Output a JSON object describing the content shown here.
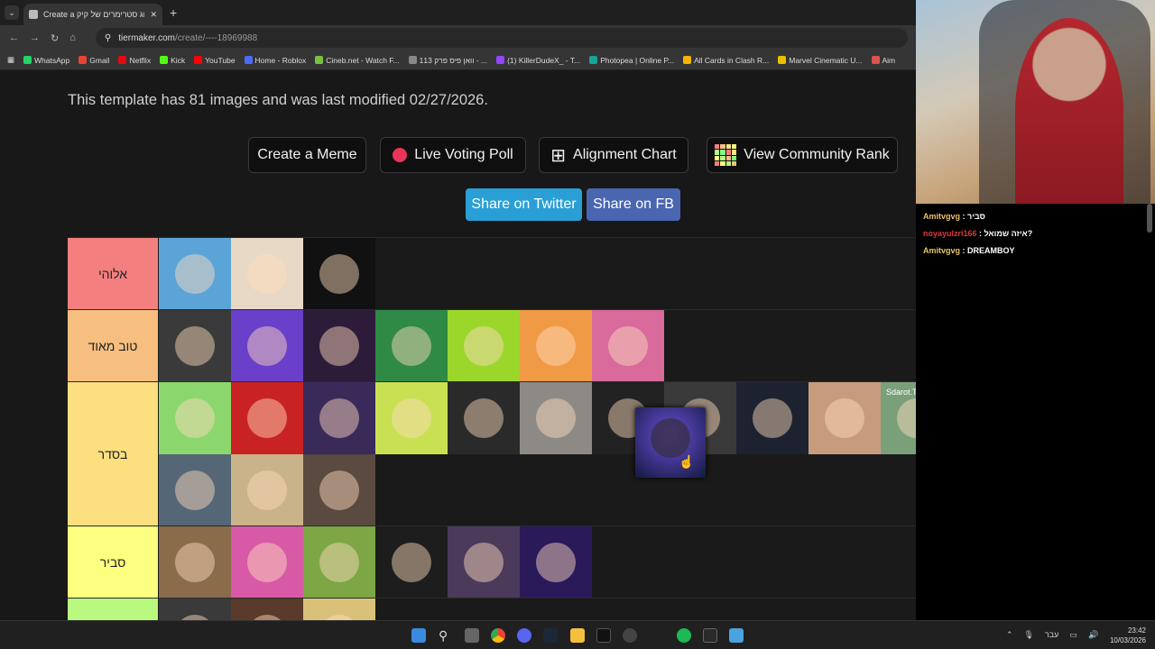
{
  "browser": {
    "tab_title": "Create a בירוג סטרימרים של קיק",
    "url_host": "tiermaker.com",
    "url_path": "/create/----18969988",
    "bookmarks": [
      {
        "label": "WhatsApp",
        "color": "#25d366"
      },
      {
        "label": "Gmail",
        "color": "#ea4335"
      },
      {
        "label": "Netflix",
        "color": "#e50914"
      },
      {
        "label": "Kick",
        "color": "#53fc18"
      },
      {
        "label": "YouTube",
        "color": "#ff0000"
      },
      {
        "label": "Home - Roblox",
        "color": "#4a6cf7"
      },
      {
        "label": "Cineb.net - Watch F...",
        "color": "#7ac143"
      },
      {
        "label": "וואן פיס פרק 113 - ...",
        "color": "#888888"
      },
      {
        "label": "(1) KillerDudeX_ - T...",
        "color": "#9146ff"
      },
      {
        "label": "Photopea | Online P...",
        "color": "#18a497"
      },
      {
        "label": "All Cards in Clash R...",
        "color": "#f5b400"
      },
      {
        "label": "Marvel Cinematic U...",
        "color": "#e8c000"
      },
      {
        "label": "Aim",
        "color": "#d9534f"
      }
    ]
  },
  "page": {
    "info_text": "This template has 81 images and was last modified 02/27/2026.",
    "buttons": {
      "create_meme": "Create a Meme",
      "live_poll": "Live Voting Poll",
      "alignment": "Alignment Chart",
      "community_rank": "View Community Rank",
      "share_twitter": "Share on Twitter",
      "share_fb": "Share on FB"
    },
    "tiers": [
      {
        "label": "אלוהי",
        "color": "#f47f7f",
        "items": [
          "#5ba4d8",
          "#e8d9c6",
          "#111111"
        ]
      },
      {
        "label": "טוב מאוד",
        "color": "#f6bf7f",
        "items": [
          "#3a3a3a",
          "#6a3fc9",
          "#2d1b3a",
          "#2f8a45",
          "#9bd62b",
          "#f09a46",
          "#d86a9c"
        ]
      },
      {
        "label": "בסדר",
        "color": "#fcdf7f",
        "items": [
          "#8cd66e",
          "#c82222",
          "#3a2a5a",
          "#c9e052",
          "#2a2a2a",
          "#8d8a86",
          "#222222",
          "#3a3a3a",
          "#1d2230",
          "#c69c7c",
          "#7aa07a",
          "#556677",
          "#c9b38a",
          "#5a4a40"
        ]
      },
      {
        "label": "סביר",
        "color": "#fcff7f",
        "items": [
          "#8a6b4a",
          "#d85aa6",
          "#7da644",
          "#1d1d1d",
          "#4b3a5a",
          "#2a1a5a"
        ]
      },
      {
        "label": "",
        "color": "#b9f97f",
        "items": [
          "#3a3a3a",
          "#5a3a2a",
          "#d9c17a"
        ]
      }
    ],
    "overlay_text": "Sdarot.TV"
  },
  "chat": [
    {
      "user": "Amitvgvg",
      "text": "סביר",
      "color": "#e8c36a"
    },
    {
      "user": "noyayulzri166",
      "text": "איזה שמואל?",
      "color": "#d93a3a"
    },
    {
      "user": "Amitvgvg",
      "text": "DREAMBOY",
      "color": "#e8c36a"
    }
  ],
  "taskbar": {
    "time": "23:42",
    "date": "10/03/2026",
    "lang": "עבר"
  },
  "icons": {
    "gear": "⚙",
    "up": "⌃",
    "down": "⌄"
  }
}
